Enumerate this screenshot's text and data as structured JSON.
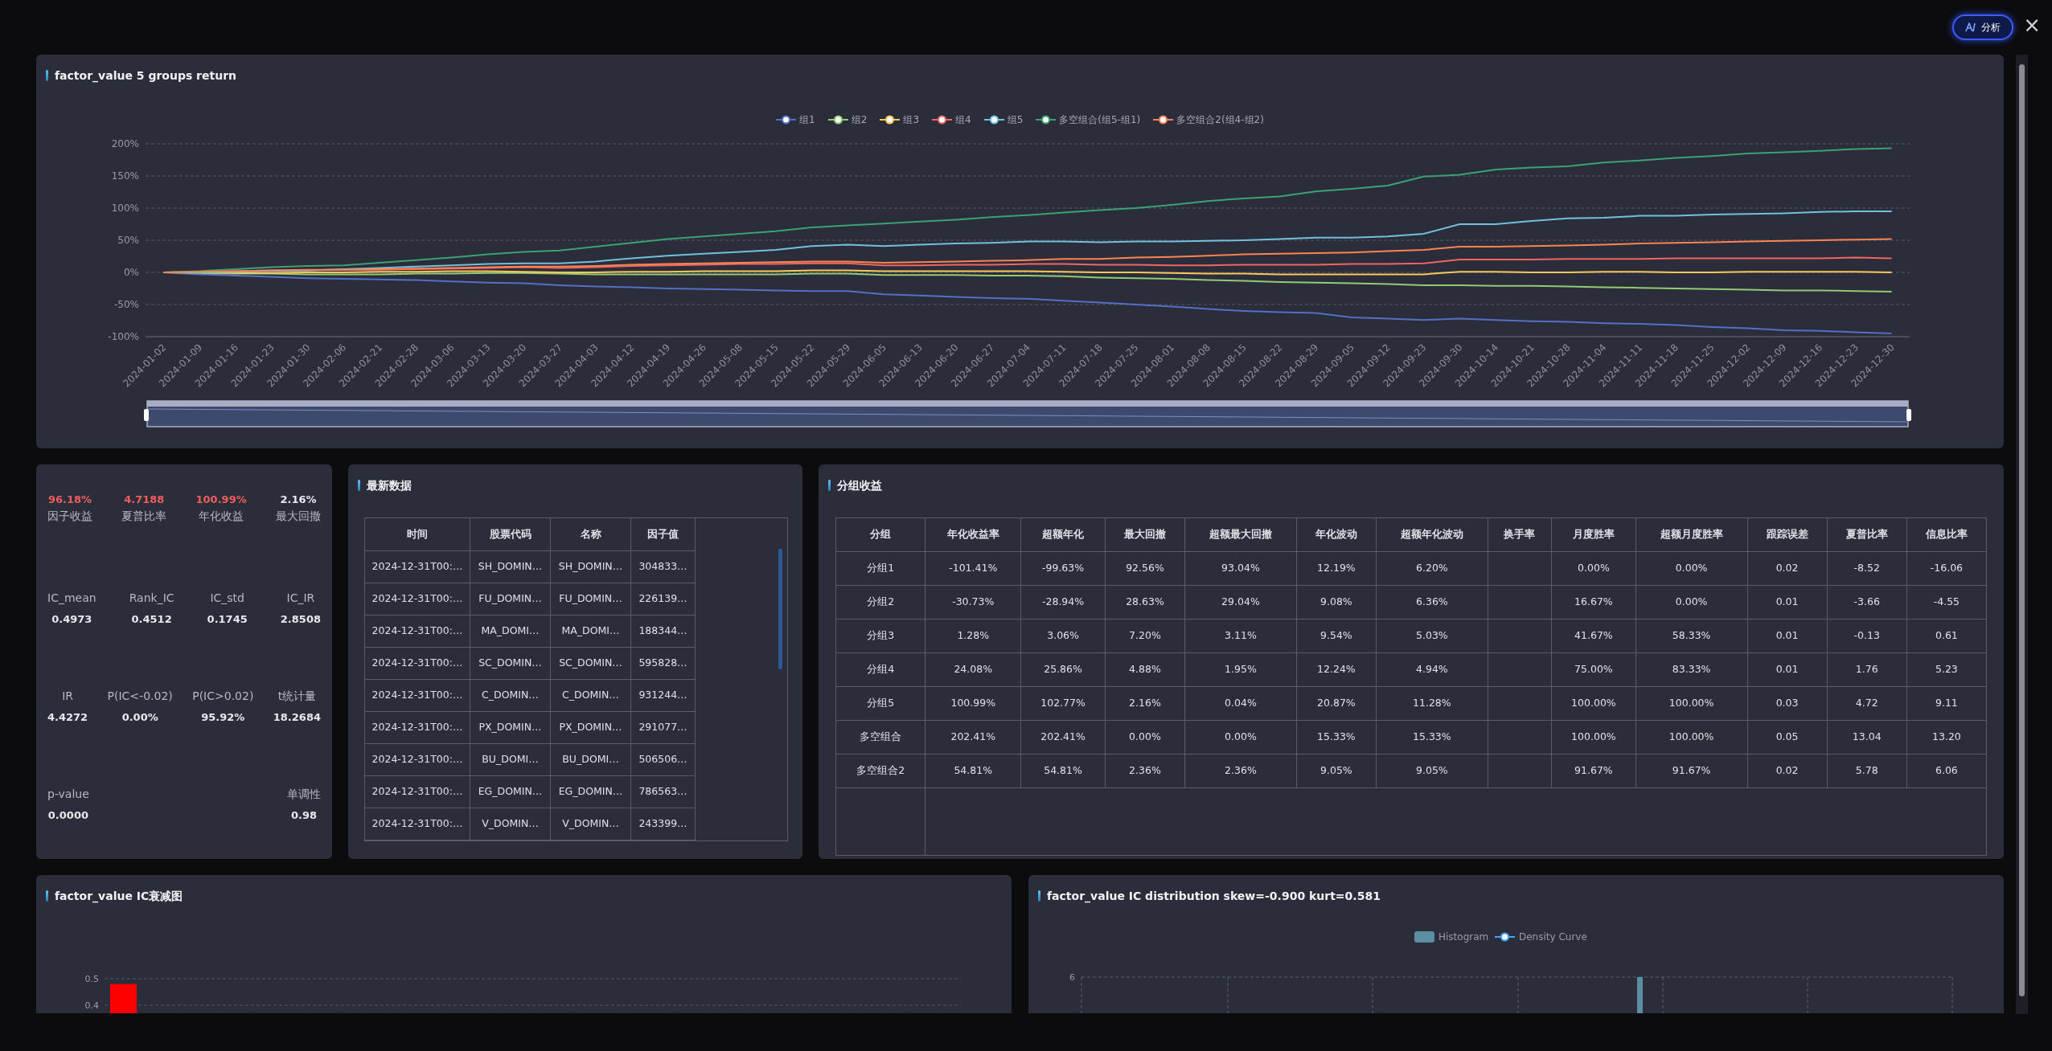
{
  "header": {
    "ai_button": {
      "label": "分析"
    },
    "close": "×"
  },
  "returns_chart": {
    "title": "factor_value 5 groups return",
    "chart_data": {
      "type": "line",
      "categories": [
        "2024-01-02",
        "2024-01-09",
        "2024-01-16",
        "2024-01-23",
        "2024-01-30",
        "2024-02-06",
        "2024-02-21",
        "2024-02-28",
        "2024-03-06",
        "2024-03-13",
        "2024-03-20",
        "2024-03-27",
        "2024-04-03",
        "2024-04-12",
        "2024-04-19",
        "2024-04-26",
        "2024-05-08",
        "2024-05-15",
        "2024-05-22",
        "2024-05-29",
        "2024-06-05",
        "2024-06-13",
        "2024-06-20",
        "2024-06-27",
        "2024-07-04",
        "2024-07-11",
        "2024-07-18",
        "2024-07-25",
        "2024-08-01",
        "2024-08-08",
        "2024-08-15",
        "2024-08-22",
        "2024-08-29",
        "2024-09-05",
        "2024-09-12",
        "2024-09-23",
        "2024-09-30",
        "2024-10-14",
        "2024-10-21",
        "2024-10-28",
        "2024-11-04",
        "2024-11-11",
        "2024-11-18",
        "2024-11-25",
        "2024-12-02",
        "2024-12-09",
        "2024-12-16",
        "2024-12-23",
        "2024-12-30"
      ],
      "series": [
        {
          "name": "组1",
          "color": "#5470c6",
          "values": [
            0,
            -3,
            -5,
            -7,
            -9,
            -10,
            -11,
            -12,
            -14,
            -16,
            -17,
            -20,
            -22,
            -23,
            -25,
            -26,
            -27,
            -28,
            -29,
            -29,
            -34,
            -36,
            -38,
            -40,
            -41,
            -44,
            -47,
            -50,
            -53,
            -57,
            -60,
            -62,
            -63,
            -70,
            -72,
            -74,
            -72,
            -74,
            -76,
            -77,
            -79,
            -80,
            -82,
            -85,
            -87,
            -90,
            -91,
            -93,
            -95
          ]
        },
        {
          "name": "组2",
          "color": "#91cc75",
          "values": [
            0,
            -1,
            -2,
            -2,
            -3,
            -3,
            -3,
            -2,
            -2,
            -1,
            -1,
            -2,
            -3,
            -3,
            -3,
            -3,
            -3,
            -3,
            -2,
            -2,
            -4,
            -4,
            -4,
            -5,
            -5,
            -6,
            -8,
            -9,
            -10,
            -12,
            -13,
            -15,
            -16,
            -17,
            -18,
            -20,
            -20,
            -21,
            -21,
            -22,
            -23,
            -24,
            -25,
            -26,
            -27,
            -28,
            -28,
            -29,
            -30
          ]
        },
        {
          "name": "组3",
          "color": "#fac858",
          "values": [
            0,
            0,
            -1,
            -1,
            0,
            0,
            1,
            1,
            2,
            2,
            1,
            0,
            0,
            1,
            1,
            2,
            2,
            2,
            3,
            3,
            2,
            2,
            2,
            2,
            2,
            1,
            0,
            0,
            -1,
            -2,
            -2,
            -3,
            -3,
            -3,
            -3,
            -3,
            1,
            1,
            0,
            0,
            1,
            1,
            0,
            0,
            1,
            1,
            1,
            1,
            0
          ]
        },
        {
          "name": "组4",
          "color": "#ee6666",
          "values": [
            0,
            1,
            2,
            3,
            3,
            4,
            4,
            5,
            6,
            7,
            8,
            7,
            8,
            10,
            11,
            12,
            13,
            13,
            14,
            14,
            11,
            11,
            12,
            12,
            13,
            13,
            12,
            12,
            11,
            11,
            12,
            12,
            12,
            13,
            13,
            14,
            20,
            20,
            20,
            21,
            21,
            21,
            22,
            22,
            22,
            22,
            22,
            23,
            22
          ]
        },
        {
          "name": "组5",
          "color": "#73c0de",
          "values": [
            0,
            0,
            1,
            2,
            3,
            5,
            7,
            9,
            11,
            13,
            14,
            14,
            17,
            22,
            26,
            29,
            32,
            35,
            41,
            43,
            41,
            43,
            45,
            46,
            48,
            48,
            47,
            48,
            48,
            49,
            50,
            52,
            54,
            54,
            56,
            60,
            75,
            75,
            80,
            84,
            85,
            88,
            88,
            90,
            91,
            92,
            94,
            95,
            95
          ]
        },
        {
          "name": "多空组合(组5-组1)",
          "color": "#3ba272",
          "values": [
            0,
            2,
            5,
            8,
            10,
            11,
            15,
            19,
            23,
            28,
            32,
            34,
            40,
            46,
            52,
            56,
            60,
            64,
            70,
            73,
            76,
            79,
            82,
            86,
            89,
            93,
            97,
            100,
            105,
            111,
            115,
            118,
            126,
            130,
            135,
            149,
            152,
            160,
            163,
            165,
            171,
            174,
            178,
            181,
            185,
            187,
            189,
            192,
            193
          ]
        },
        {
          "name": "多空组合2(组4-组2)",
          "color": "#fc8452",
          "values": [
            0,
            1,
            2,
            3,
            4,
            4,
            5,
            6,
            7,
            8,
            9,
            9,
            10,
            12,
            13,
            14,
            15,
            16,
            17,
            17,
            15,
            16,
            17,
            18,
            19,
            21,
            21,
            23,
            24,
            26,
            28,
            29,
            30,
            31,
            33,
            35,
            40,
            40,
            41,
            42,
            43,
            45,
            46,
            47,
            48,
            49,
            50,
            51,
            52
          ]
        }
      ],
      "grid": true,
      "ylim": [
        -100,
        200
      ],
      "yticks": [
        {
          "value": -100,
          "label": "-100%"
        },
        {
          "value": -50,
          "label": "-50%"
        },
        {
          "value": 0,
          "label": "0%"
        },
        {
          "value": 50,
          "label": "50%"
        },
        {
          "value": 100,
          "label": "100%"
        },
        {
          "value": 150,
          "label": "150%"
        },
        {
          "value": 200,
          "label": "200%"
        }
      ]
    }
  },
  "stats": {
    "rows": [
      {
        "kind": "headline",
        "items": [
          {
            "label": "因子收益",
            "value": "96.18%",
            "highlight": true
          },
          {
            "label": "夏普比率",
            "value": "4.7188",
            "highlight": true
          },
          {
            "label": "年化收益",
            "value": "100.99%",
            "highlight": true
          },
          {
            "label": "最大回撤",
            "value": "2.16%",
            "highlight": false
          }
        ]
      },
      {
        "kind": "metric",
        "items": [
          {
            "label": "IC_mean",
            "value": "0.4973"
          },
          {
            "label": "Rank_IC",
            "value": "0.4512"
          },
          {
            "label": "IC_std",
            "value": "0.1745"
          },
          {
            "label": "IC_IR",
            "value": "2.8508"
          }
        ]
      },
      {
        "kind": "metric",
        "items": [
          {
            "label": "IR",
            "value": "4.4272"
          },
          {
            "label": "P(IC<-0.02)",
            "value": "0.00%"
          },
          {
            "label": "P(IC>0.02)",
            "value": "95.92%"
          },
          {
            "label": "t统计量",
            "value": "18.2684"
          }
        ]
      },
      {
        "kind": "metric",
        "items": [
          {
            "label": "p-value",
            "value": "0.0000"
          },
          {
            "label": "单调性",
            "value": "0.98"
          }
        ]
      }
    ]
  },
  "latest": {
    "title": "最新数据",
    "columns": [
      "时间",
      "股票代码",
      "名称",
      "因子值"
    ],
    "rows": [
      [
        "2024-12-31T00:…",
        "SH_DOMIN…",
        "SH_DOMIN…",
        "304833…"
      ],
      [
        "2024-12-31T00:…",
        "FU_DOMIN…",
        "FU_DOMIN…",
        "226139…"
      ],
      [
        "2024-12-31T00:…",
        "MA_DOMI…",
        "MA_DOMI…",
        "188344…"
      ],
      [
        "2024-12-31T00:…",
        "SC_DOMIN…",
        "SC_DOMIN…",
        "595828…"
      ],
      [
        "2024-12-31T00:…",
        "C_DOMIN…",
        "C_DOMIN…",
        "931244…"
      ],
      [
        "2024-12-31T00:…",
        "PX_DOMIN…",
        "PX_DOMIN…",
        "291077…"
      ],
      [
        "2024-12-31T00:…",
        "BU_DOMI…",
        "BU_DOMI…",
        "506506…"
      ],
      [
        "2024-12-31T00:…",
        "EG_DOMIN…",
        "EG_DOMIN…",
        "786563…"
      ],
      [
        "2024-12-31T00:…",
        "V_DOMIN…",
        "V_DOMIN…",
        "243399…"
      ]
    ]
  },
  "groups": {
    "title": "分组收益",
    "columns": [
      "分组",
      "年化收益率",
      "超额年化",
      "最大回撤",
      "超额最大回撤",
      "年化波动",
      "超额年化波动",
      "换手率",
      "月度胜率",
      "超额月度胜率",
      "跟踪误差",
      "夏普比率",
      "信息比率"
    ],
    "rows": [
      [
        "分组1",
        "-101.41%",
        "-99.63%",
        "92.56%",
        "93.04%",
        "12.19%",
        "6.20%",
        null,
        "0.00%",
        "0.00%",
        "0.02",
        "-8.52",
        "-16.06"
      ],
      [
        "分组2",
        "-30.73%",
        "-28.94%",
        "28.63%",
        "29.04%",
        "9.08%",
        "6.36%",
        null,
        "16.67%",
        "0.00%",
        "0.01",
        "-3.66",
        "-4.55"
      ],
      [
        "分组3",
        "1.28%",
        "3.06%",
        "7.20%",
        "3.11%",
        "9.54%",
        "5.03%",
        null,
        "41.67%",
        "58.33%",
        "0.01",
        "-0.13",
        "0.61"
      ],
      [
        "分组4",
        "24.08%",
        "25.86%",
        "4.88%",
        "1.95%",
        "12.24%",
        "4.94%",
        null,
        "75.00%",
        "83.33%",
        "0.01",
        "1.76",
        "5.23"
      ],
      [
        "分组5",
        "100.99%",
        "102.77%",
        "2.16%",
        "0.04%",
        "20.87%",
        "11.28%",
        null,
        "100.00%",
        "100.00%",
        "0.03",
        "4.72",
        "9.11"
      ],
      [
        "多空组合",
        "202.41%",
        "202.41%",
        "0.00%",
        "0.00%",
        "15.33%",
        "15.33%",
        null,
        "100.00%",
        "100.00%",
        "0.05",
        "13.04",
        "13.20"
      ],
      [
        "多空组合2",
        "54.81%",
        "54.81%",
        "2.36%",
        "2.36%",
        "9.05%",
        "9.05%",
        null,
        "91.67%",
        "91.67%",
        "0.02",
        "5.78",
        "6.06"
      ]
    ]
  },
  "ic_decay": {
    "title": "factor_value IC衰减图",
    "chart_data": {
      "type": "bar",
      "values": [
        0.48
      ],
      "grid": true,
      "ylim": [
        0,
        0.5
      ],
      "yticks": [
        0.4,
        0.5
      ]
    }
  },
  "ic_distribution": {
    "title": "factor_value IC distribution skew=-0.900 kurt=0.581",
    "legend": [
      "Histogram",
      "Density Curve"
    ],
    "y_tick_label": "6"
  }
}
